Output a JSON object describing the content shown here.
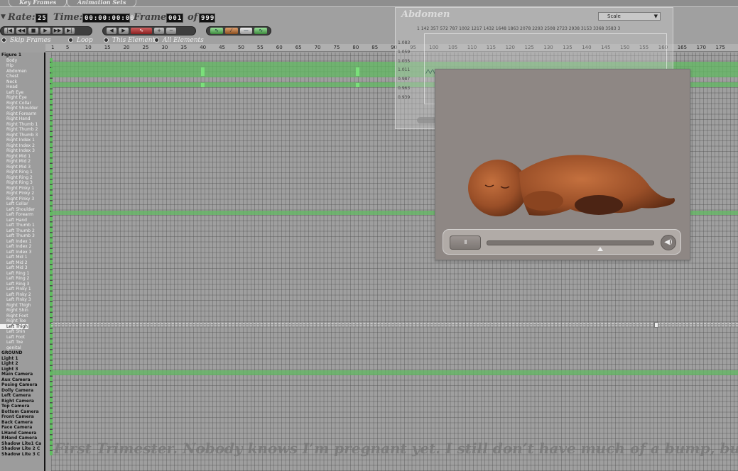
{
  "tabs": [
    {
      "label": "Key Frames"
    },
    {
      "label": "Animation Sets"
    }
  ],
  "header": {
    "rate_label": "Rate:",
    "rate_value": "25",
    "time_label": "Time:",
    "time_value": "00:00:00:00",
    "frame_label": "Frame:",
    "frame_value": "001",
    "of_label": "of",
    "frame_total": "999",
    "options": {
      "skip_frames": "Skip Frames",
      "loop": "Loop",
      "this_element": "This Element",
      "all_elements": "All Elements"
    }
  },
  "ruler": {
    "ticks": [
      "1",
      "5",
      "10",
      "15",
      "20",
      "25",
      "30",
      "35",
      "40",
      "45",
      "50",
      "55",
      "60",
      "65",
      "70",
      "75",
      "80",
      "85",
      "90",
      "95",
      "100",
      "105",
      "110",
      "115",
      "120",
      "125",
      "130",
      "135",
      "140",
      "145",
      "150",
      "155",
      "160",
      "165",
      "170",
      "175"
    ]
  },
  "tree": {
    "root": "Figure 1",
    "parts": [
      "Body",
      "Hip",
      "Abdomen",
      "Chest",
      "Neck",
      "Head",
      "Left Eye",
      "Right Eye",
      "Right Collar",
      "Right Shoulder",
      "Right Forearm",
      "Right Hand",
      "Right Thumb 1",
      "Right Thumb 2",
      "Right Thumb 3",
      "Right Index 1",
      "Right Index 2",
      "Right Index 3",
      "Right Mid 1",
      "Right Mid 2",
      "Right Mid 3",
      "Right Ring 1",
      "Right Ring 2",
      "Right Ring 3",
      "Right Pinky 1",
      "Right Pinky 2",
      "Right Pinky 3",
      "Left Collar",
      "Left Shoulder",
      "Left Forearm",
      "Left Hand",
      "Left Thumb 1",
      "Left Thumb 2",
      "Left Thumb 3",
      "Left Index 1",
      "Left Index 2",
      "Left Index 3",
      "Left Mid 1",
      "Left Mid 2",
      "Left Mid 3",
      "Left Ring 1",
      "Left Ring 2",
      "Left Ring 3",
      "Left Pinky 1",
      "Left Pinky 2",
      "Left Pinky 3",
      "Right Thigh",
      "Right Shin",
      "Right Foot",
      "Right Toe",
      "Left Thigh",
      "Left Shin",
      "Left Foot",
      "Left Toe",
      "genital"
    ],
    "selected": "Left Thigh",
    "objects": [
      "GROUND",
      "Light 1",
      "Light 2",
      "Light 3",
      "Main Camera",
      "Aux Camera",
      "Posing Camera",
      "Dolly Camera",
      "Left Camera",
      "Right Camera",
      "Top Camera",
      "Bottom Camera",
      "Front Camera",
      "Back Camera",
      "Face Camera",
      "LHand Camera",
      "RHand Camera",
      "Shadow Lite1 Ca",
      "Shadow Lite 2 C",
      "Shadow Lite 3 C"
    ]
  },
  "graph": {
    "title": "Abdomen",
    "param": "Scale",
    "frame_ticks": "1  142  357  572  787  1002 1217 1432 1648 1863 2078 2293 2508 2723 2938 3153 3368 3583 3",
    "y_values": [
      "1.083",
      "1.059",
      "1.035",
      "1.011",
      "0.987",
      "0.963",
      "0.939"
    ],
    "curve_label": "/\\/\\/\\/\\/\\/\\/\\/\\/\\/\\/\\/\\/\\/\\/\\/\\/\\/\\/\\/\\/\\/\\/\\/\\/\\/\\/\\/\\/\\/\\/\\/\\/\\/\\/\\/\\/\\/\\/\\/\\/\\"
  },
  "player": {
    "pause_symbol": "II",
    "volume_symbol": "◀)"
  },
  "caption": "First Trimester. Nobody knows I’m pregnant yet.  I still don’t have much of a bump, but working on th"
}
